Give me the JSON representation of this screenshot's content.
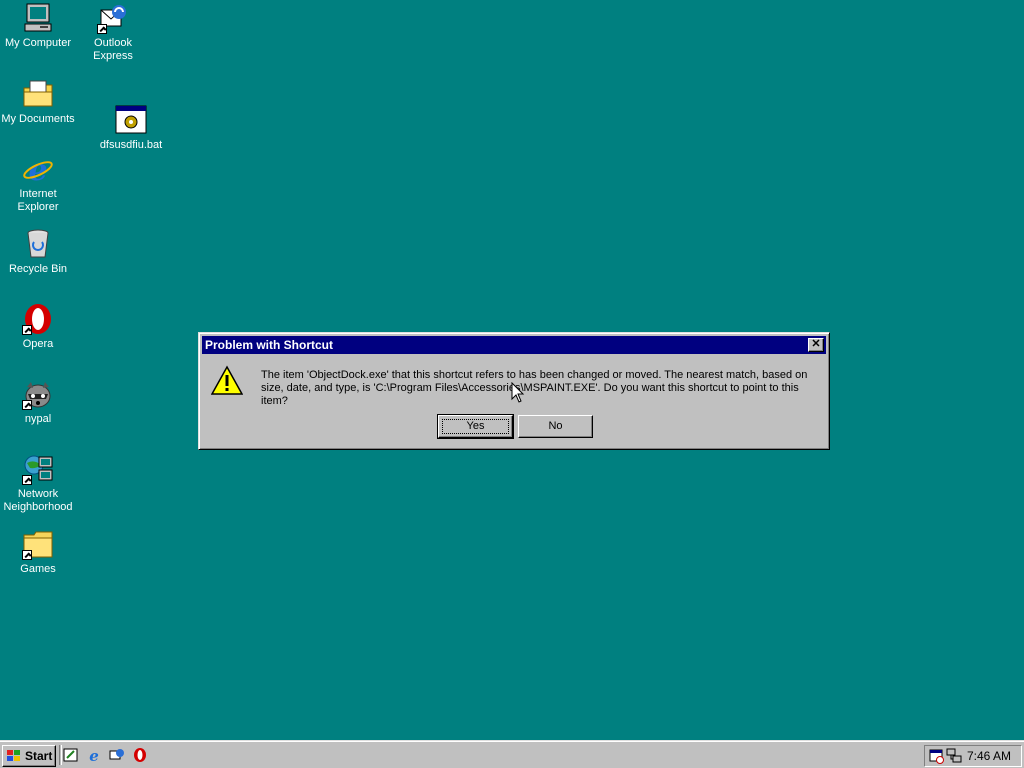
{
  "desktop": {
    "background_color": "#008080",
    "icons": [
      {
        "label": "My Computer",
        "icon": "my-computer-icon"
      },
      {
        "label": "Outlook Express",
        "icon": "outlook-express-icon"
      },
      {
        "label": "My Documents",
        "icon": "my-documents-icon"
      },
      {
        "label": "dfsusdfiu.bat",
        "icon": "batch-file-icon"
      },
      {
        "label": "Internet Explorer",
        "icon": "internet-explorer-icon"
      },
      {
        "label": "Recycle Bin",
        "icon": "recycle-bin-icon"
      },
      {
        "label": "Opera",
        "icon": "opera-icon"
      },
      {
        "label": "nypal",
        "icon": "raccoon-icon"
      },
      {
        "label": "Network Neighborhood",
        "icon": "network-neighborhood-icon"
      },
      {
        "label": "Games",
        "icon": "folder-icon"
      }
    ]
  },
  "dialog": {
    "title": "Problem with Shortcut",
    "close_label": "✕",
    "message": "The item 'ObjectDock.exe' that this shortcut refers to has been changed or moved. The nearest match, based on size, date, and type, is 'C:\\Program Files\\Accessories\\MSPAINT.EXE'. Do you want this shortcut to point to this item?",
    "yes_label": "Yes",
    "no_label": "No",
    "icon": "warning-icon",
    "titlebar_color": "#000080"
  },
  "taskbar": {
    "start_label": "Start",
    "quick_launch": [
      "show-desktop-icon",
      "internet-explorer-icon",
      "outlook-express-icon",
      "opera-icon"
    ],
    "tray_icons": [
      "scheduler-icon",
      "network-icon"
    ],
    "clock": "7:46 AM"
  }
}
